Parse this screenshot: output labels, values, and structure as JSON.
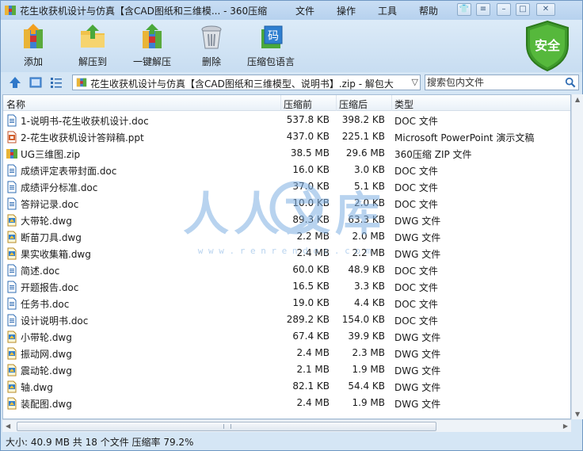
{
  "window": {
    "title": "花生收获机设计与仿真【含CAD图纸和三维模... - 360压缩",
    "menu": [
      "文件",
      "操作",
      "工具",
      "帮助"
    ]
  },
  "toolbar": {
    "items": [
      {
        "label": "添加",
        "icon": "add-icon"
      },
      {
        "label": "解压到",
        "icon": "extract-to-icon"
      },
      {
        "label": "一键解压",
        "icon": "one-click-extract-icon"
      },
      {
        "label": "删除",
        "icon": "delete-icon"
      },
      {
        "label": "压缩包语言",
        "icon": "archive-language-icon"
      }
    ],
    "shield_label": "安全",
    "language_glyph": "码"
  },
  "address": {
    "path": "花生收获机设计与仿真【含CAD图纸和三维模型、说明书】.zip - 解包大",
    "search_placeholder": "搜索包内文件"
  },
  "columns": {
    "name": "名称",
    "compressed": "压缩前",
    "uncompressed": "压缩后",
    "type": "类型"
  },
  "watermark": {
    "text": "人人文库",
    "url": "w w w . r e n r e n d o c . c o m"
  },
  "files": [
    {
      "name": "1-说明书-花生收获机设计.doc",
      "before": "537.8 KB",
      "after": "398.2 KB",
      "type": "DOC 文件",
      "kind": "doc"
    },
    {
      "name": "2-花生收获机设计答辩稿.ppt",
      "before": "437.0 KB",
      "after": "225.1 KB",
      "type": "Microsoft PowerPoint 演示文稿",
      "kind": "ppt"
    },
    {
      "name": "UG三维图.zip",
      "before": "38.5 MB",
      "after": "29.6 MB",
      "type": "360压缩 ZIP 文件",
      "kind": "zip"
    },
    {
      "name": "成绩评定表带封面.doc",
      "before": "16.0 KB",
      "after": "3.0 KB",
      "type": "DOC 文件",
      "kind": "doc"
    },
    {
      "name": "成绩评分标准.doc",
      "before": "37.0 KB",
      "after": "5.1 KB",
      "type": "DOC 文件",
      "kind": "doc"
    },
    {
      "name": "答辩记录.doc",
      "before": "10.0 KB",
      "after": "2.0 KB",
      "type": "DOC 文件",
      "kind": "doc"
    },
    {
      "name": "大带轮.dwg",
      "before": "89.3 KB",
      "after": "63.3 KB",
      "type": "DWG 文件",
      "kind": "dwg"
    },
    {
      "name": "断苗刀具.dwg",
      "before": "2.2 MB",
      "after": "2.0 MB",
      "type": "DWG 文件",
      "kind": "dwg"
    },
    {
      "name": "果实收集箱.dwg",
      "before": "2.4 MB",
      "after": "2.2 MB",
      "type": "DWG 文件",
      "kind": "dwg"
    },
    {
      "name": "简述.doc",
      "before": "60.0 KB",
      "after": "48.9 KB",
      "type": "DOC 文件",
      "kind": "doc"
    },
    {
      "name": "开题报告.doc",
      "before": "16.5 KB",
      "after": "3.3 KB",
      "type": "DOC 文件",
      "kind": "doc"
    },
    {
      "name": "任务书.doc",
      "before": "19.0 KB",
      "after": "4.4 KB",
      "type": "DOC 文件",
      "kind": "doc"
    },
    {
      "name": "设计说明书.doc",
      "before": "289.2 KB",
      "after": "154.0 KB",
      "type": "DOC 文件",
      "kind": "doc"
    },
    {
      "name": "小带轮.dwg",
      "before": "67.4 KB",
      "after": "39.9 KB",
      "type": "DWG 文件",
      "kind": "dwg"
    },
    {
      "name": "振动网.dwg",
      "before": "2.4 MB",
      "after": "2.3 MB",
      "type": "DWG 文件",
      "kind": "dwg"
    },
    {
      "name": "震动轮.dwg",
      "before": "2.1 MB",
      "after": "1.9 MB",
      "type": "DWG 文件",
      "kind": "dwg"
    },
    {
      "name": "轴.dwg",
      "before": "82.1 KB",
      "after": "54.4 KB",
      "type": "DWG 文件",
      "kind": "dwg"
    },
    {
      "name": "装配图.dwg",
      "before": "2.4 MB",
      "after": "1.9 MB",
      "type": "DWG 文件",
      "kind": "dwg"
    }
  ],
  "status": "大小: 40.9 MB 共 18 个文件 压缩率 79.2%"
}
